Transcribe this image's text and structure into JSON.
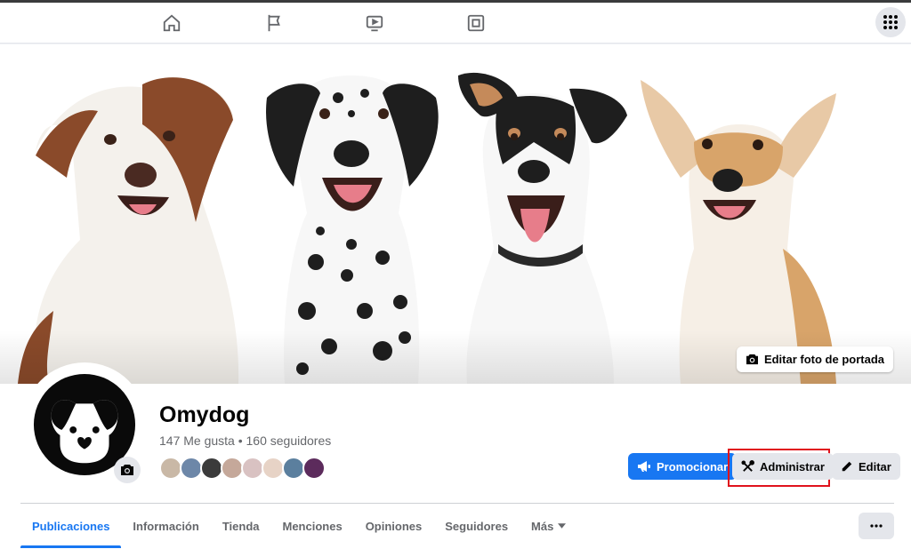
{
  "cover": {
    "edit_label": "Editar foto de portada"
  },
  "page": {
    "name": "Omydog",
    "stats": "147 Me gusta • 160 seguidores"
  },
  "followers": [
    "#c9b8a6",
    "#6d87a8",
    "#3b3b3b",
    "#c5a89a",
    "#d9c2c2",
    "#e7d3c6",
    "#5b7f9e",
    "#5c2b5c"
  ],
  "actions": {
    "promote_label": "Promocionar",
    "admin_label": "Administrar",
    "edit_label": "Editar"
  },
  "tabs": [
    {
      "label": "Publicaciones"
    },
    {
      "label": "Información"
    },
    {
      "label": "Tienda"
    },
    {
      "label": "Menciones"
    },
    {
      "label": "Opiniones"
    },
    {
      "label": "Seguidores"
    },
    {
      "label": "Más"
    }
  ],
  "colors": {
    "accent": "#1877f2",
    "highlight": "#e0121c"
  }
}
